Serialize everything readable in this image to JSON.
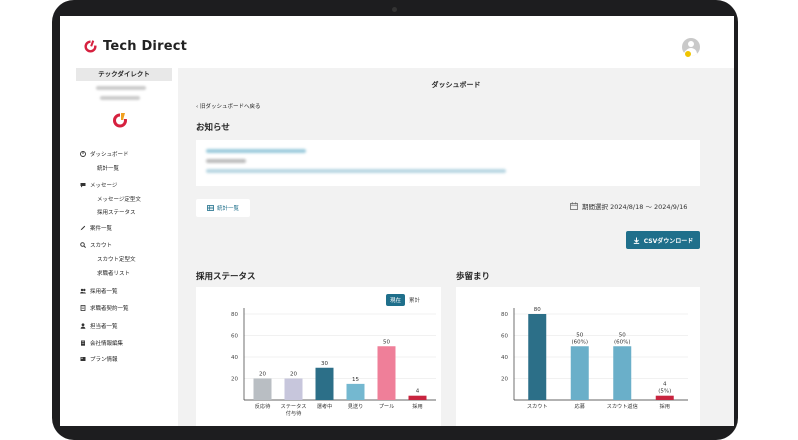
{
  "header": {
    "brand": "Tech Direct"
  },
  "sidebar": {
    "company_name": "テックダイレクト",
    "items": [
      {
        "label": "ダッシュボード",
        "icon": "dashboard-icon",
        "sub": false
      },
      {
        "label": "統計一覧",
        "icon": "",
        "sub": true
      },
      {
        "label": "メッセージ",
        "icon": "chat-icon",
        "sub": false
      },
      {
        "label": "メッセージ定型文",
        "icon": "",
        "sub": true
      },
      {
        "label": "採用ステータス",
        "icon": "",
        "sub": true
      },
      {
        "label": "案件一覧",
        "icon": "pencil-icon",
        "sub": false
      },
      {
        "label": "スカウト",
        "icon": "search-icon",
        "sub": false
      },
      {
        "label": "スカウト定型文",
        "icon": "",
        "sub": true
      },
      {
        "label": "求職者リスト",
        "icon": "",
        "sub": true
      },
      {
        "label": "採用者一覧",
        "icon": "users-icon",
        "sub": false
      },
      {
        "label": "求職者契約一覧",
        "icon": "document-icon",
        "sub": false
      },
      {
        "label": "担当者一覧",
        "icon": "person-icon",
        "sub": false
      },
      {
        "label": "会社情報編集",
        "icon": "building-icon",
        "sub": false
      },
      {
        "label": "プラン情報",
        "icon": "card-icon",
        "sub": false
      }
    ]
  },
  "main": {
    "page_title": "ダッシュボード",
    "back_link": "旧ダッシュボードへ戻る",
    "notice_title": "お知らせ",
    "stats_button": "統計一覧",
    "period_label": "期間選択 2024/8/18 〜 2024/9/16",
    "csv_button": "CSVダウンロード",
    "status_title": "採用ステータス",
    "yield_title": "歩留まり",
    "toggle_current": "現在",
    "toggle_cumulative": "累計"
  },
  "colors": {
    "accent": "#1f6f8b",
    "brand_red": "#d6213f"
  },
  "chart_data": [
    {
      "type": "bar",
      "title": "採用ステータス",
      "categories": [
        "反応待",
        "ステータス付与待",
        "選考中",
        "見送り",
        "プール",
        "採用"
      ],
      "category_lines": [
        [
          "反応待"
        ],
        [
          "ステータス",
          "付与待"
        ],
        [
          "選考中"
        ],
        [
          "見送り"
        ],
        [
          "プール"
        ],
        [
          "採用"
        ]
      ],
      "values": [
        20,
        20,
        30,
        15,
        50,
        4
      ],
      "colors": [
        "#b9bec3",
        "#c7c6dc",
        "#2c6f88",
        "#74b8d0",
        "#ef7f99",
        "#c8243f"
      ],
      "ylim": [
        0,
        80
      ],
      "yticks": [
        20,
        40,
        60,
        80
      ]
    },
    {
      "type": "bar",
      "title": "歩留まり",
      "categories": [
        "スカウト",
        "応募",
        "スカウト返信",
        "採用"
      ],
      "values": [
        80,
        50,
        50,
        4
      ],
      "value_labels": [
        [
          "80"
        ],
        [
          "50",
          "(60%)"
        ],
        [
          "50",
          "(60%)"
        ],
        [
          "4",
          "(5%)"
        ]
      ],
      "colors": [
        "#2c6f88",
        "#6aafc9",
        "#6aafc9",
        "#c8243f"
      ],
      "ylim": [
        0,
        80
      ],
      "yticks": [
        20,
        40,
        60,
        80
      ]
    }
  ]
}
